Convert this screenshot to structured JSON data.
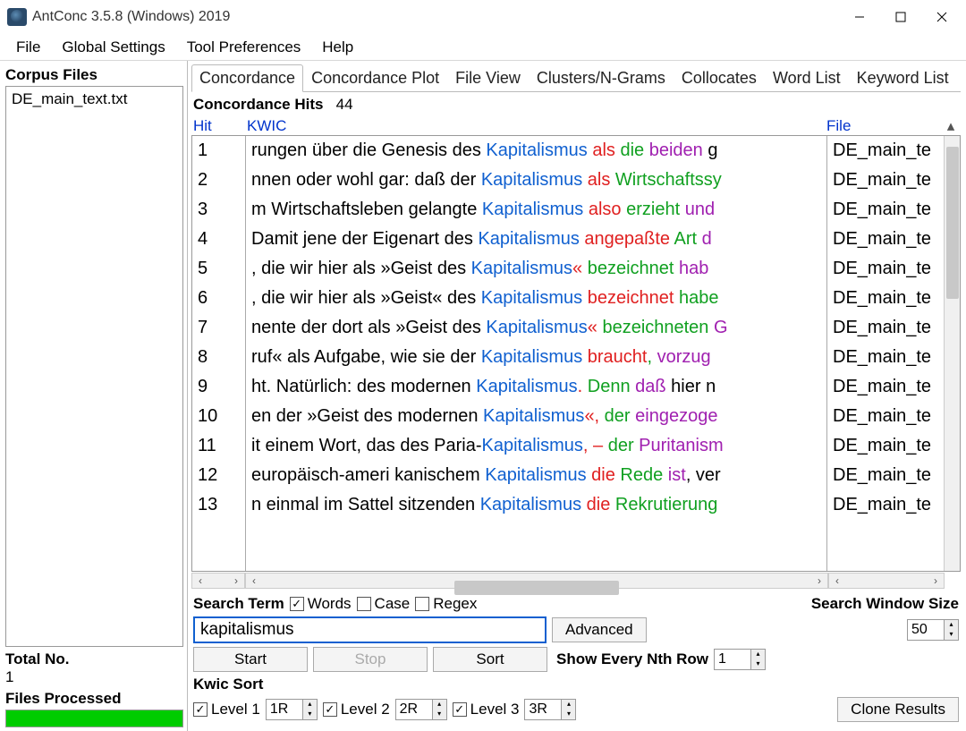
{
  "window": {
    "title": "AntConc 3.5.8 (Windows) 2019"
  },
  "menu": [
    "File",
    "Global Settings",
    "Tool Preferences",
    "Help"
  ],
  "sidebar": {
    "label": "Corpus Files",
    "files": [
      "DE_main_text.txt"
    ],
    "total_label": "Total No.",
    "total_value": "1",
    "processed_label": "Files Processed"
  },
  "tabs": [
    "Concordance",
    "Concordance Plot",
    "File View",
    "Clusters/N-Grams",
    "Collocates",
    "Word List",
    "Keyword List"
  ],
  "hits": {
    "label": "Concordance Hits",
    "value": "44"
  },
  "columns": {
    "hit": "Hit",
    "kwic": "KWIC",
    "file": "File"
  },
  "rows": [
    {
      "n": "1",
      "left": "rungen über die Genesis des ",
      "kw": "Kapitalismus",
      "r1": " als",
      "r2": " die",
      "r3": " beiden",
      "r4": " g",
      "file": "DE_main_te"
    },
    {
      "n": "2",
      "left": "nnen oder wohl gar: daß der ",
      "kw": "Kapitalismus",
      "r1": " als",
      "r2": " Wirtschaftssy",
      "r3": "",
      "r4": "",
      "file": "DE_main_te"
    },
    {
      "n": "3",
      "left": "m Wirtschaftsleben gelangte ",
      "kw": "Kapitalismus",
      "r1": " also",
      "r2": " erzieht",
      "r3": " und",
      "r4": "",
      "file": "DE_main_te"
    },
    {
      "n": "4",
      "left": "Damit jene der Eigenart des ",
      "kw": "Kapitalismus",
      "r1": " angepaßte",
      "r2": " Art",
      "r3": " d",
      "r4": "",
      "file": "DE_main_te"
    },
    {
      "n": "5",
      "left": ", die wir hier als »Geist des ",
      "kw": "Kapitalismus",
      "r1": "«",
      "r2": " bezeichnet",
      "r3": " hab",
      "r4": "",
      "file": "DE_main_te"
    },
    {
      "n": "6",
      "left": ", die wir hier als »Geist« des ",
      "kw": "Kapitalismus",
      "r1": " bezeichnet",
      "r2": " habe",
      "r3": "",
      "r4": "",
      "file": "DE_main_te"
    },
    {
      "n": "7",
      "left": "nente der dort als »Geist des ",
      "kw": "Kapitalismus",
      "r1": "«",
      "r2": " bezeichneten",
      "r3": " G",
      "r4": "",
      "file": "DE_main_te"
    },
    {
      "n": "8",
      "left": "ruf« als Aufgabe, wie sie der ",
      "kw": "Kapitalismus",
      "r1": " braucht",
      "r2": ",",
      "r3": " vorzug",
      "r4": "",
      "file": "DE_main_te"
    },
    {
      "n": "9",
      "left": "ht. Natürlich: des modernen ",
      "kw": "Kapitalismus",
      "r1": ".",
      "r2": " Denn",
      "r3": " daß",
      "r4": " hier n",
      "file": "DE_main_te"
    },
    {
      "n": "10",
      "left": "en der »Geist des modernen ",
      "kw": "Kapitalismus",
      "r1": "«,",
      "r2": " der",
      "r3": " eingezoge",
      "r4": "",
      "file": "DE_main_te"
    },
    {
      "n": "11",
      "left": "it einem Wort, das des Paria-",
      "kw": "Kapitalismus",
      "r1": ", –",
      "r2": " der",
      "r3": " Puritanism",
      "r4": "",
      "file": "DE_main_te"
    },
    {
      "n": "12",
      "left": "europäisch-ameri kanischem ",
      "kw": "Kapitalismus",
      "r1": " die",
      "r2": " Rede",
      "r3": " ist",
      ", ver": "",
      "r4": ", ver",
      "file": "DE_main_te"
    },
    {
      "n": "13",
      "left": "n einmal im Sattel sitzenden ",
      "kw": "Kapitalismus",
      "r1": " die",
      "r2": " Rekrutierung",
      "r3": "",
      "r4": "",
      "file": "DE_main_te"
    }
  ],
  "search": {
    "term_label": "Search Term",
    "words": "Words",
    "case": "Case",
    "regex": "Regex",
    "value": "kapitalismus",
    "advanced": "Advanced",
    "window_label": "Search Window Size",
    "window_value": "50"
  },
  "buttons": {
    "start": "Start",
    "stop": "Stop",
    "sort": "Sort",
    "nth_label": "Show Every Nth Row",
    "nth_value": "1",
    "clone": "Clone Results"
  },
  "kwicsort": {
    "label": "Kwic Sort",
    "l1": "Level 1",
    "v1": "1R",
    "l2": "Level 2",
    "v2": "2R",
    "l3": "Level 3",
    "v3": "3R"
  }
}
